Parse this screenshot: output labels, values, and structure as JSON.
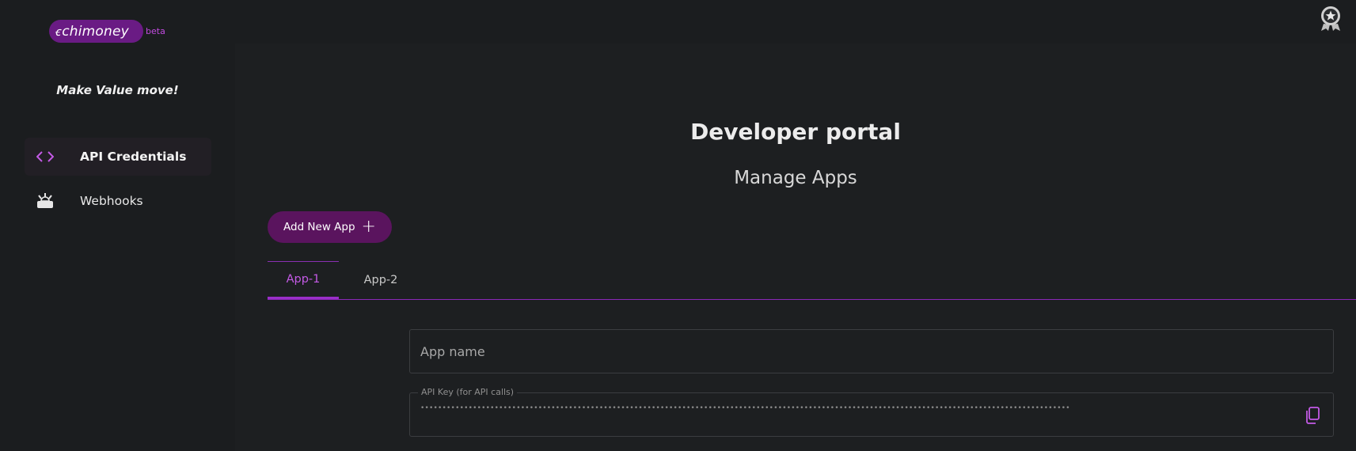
{
  "brand": {
    "name": "chimoney",
    "badge": "beta",
    "accent": "#6a1b84"
  },
  "sidebar": {
    "tagline": "Make Value move!",
    "items": [
      {
        "label": "API Credentials",
        "icon": "code-brackets-icon",
        "active": true
      },
      {
        "label": "Webhooks",
        "icon": "webhook-icon",
        "active": false
      }
    ]
  },
  "header": {
    "icon": "award-badge-icon"
  },
  "main": {
    "title": "Developer portal",
    "subtitle": "Manage Apps",
    "add_button": "Add New App",
    "tabs": [
      {
        "label": "App-1",
        "active": true
      },
      {
        "label": "App-2",
        "active": false
      }
    ],
    "app_name_placeholder": "App name",
    "api_key_label": "API Key (for API calls)",
    "api_key_value": "••••••••••••••••••••••••••••••••••••••••••••••••••••••••••••••••••••••••••••••••••••••••••••••••••••••••••••••••••••••••••••••••••••••••••••••••••••••••••••••••••••••••••••••••••••••••••••••••••••••••••••"
  },
  "colors": {
    "tab_active": "#c45ae6",
    "tab_underline": "#8a28b8",
    "button": "#5a145e"
  }
}
